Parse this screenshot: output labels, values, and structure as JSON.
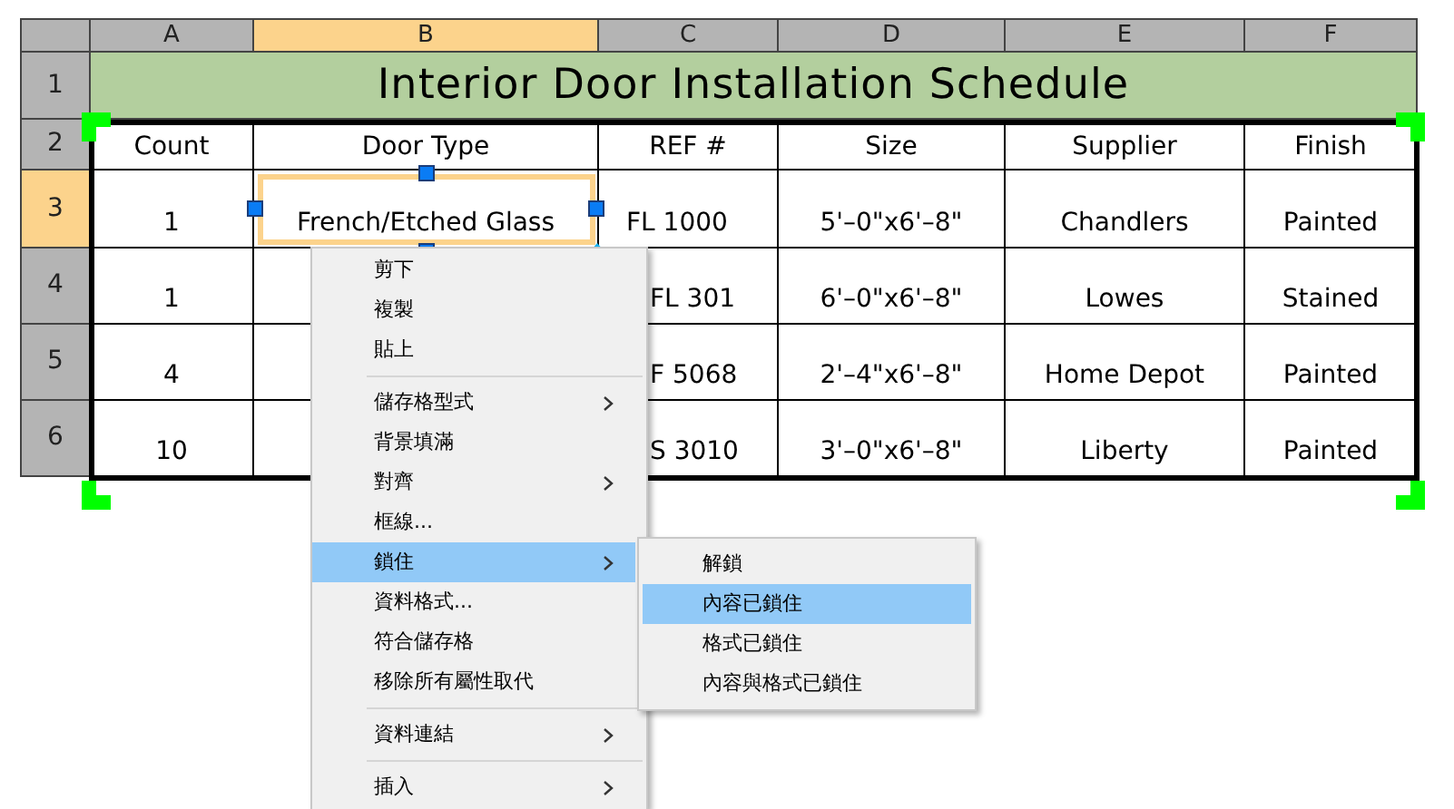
{
  "column_headers": [
    {
      "label": "A",
      "selected": false
    },
    {
      "label": "B",
      "selected": true
    },
    {
      "label": "C",
      "selected": false
    },
    {
      "label": "D",
      "selected": false
    },
    {
      "label": "E",
      "selected": false
    },
    {
      "label": "F",
      "selected": false
    }
  ],
  "row_headers": [
    {
      "label": "1",
      "selected": false
    },
    {
      "label": "2",
      "selected": false
    },
    {
      "label": "3",
      "selected": true
    },
    {
      "label": "4",
      "selected": false
    },
    {
      "label": "5",
      "selected": false
    },
    {
      "label": "6",
      "selected": false
    }
  ],
  "title": "Interior Door Installation Schedule",
  "header": [
    "Count",
    "Door Type",
    "REF #",
    "Size",
    "Supplier",
    "Finish"
  ],
  "data_rows": [
    {
      "cells": [
        {
          "text": "1",
          "selected": false
        },
        {
          "text": "French/Etched Glass",
          "selected": true
        },
        {
          "text": "FL 1000",
          "selected": false
        },
        {
          "text": "5'–0\"x6'–8\"",
          "selected": false
        },
        {
          "text": "Chandlers",
          "selected": false
        },
        {
          "text": "Painted",
          "selected": false
        }
      ]
    },
    {
      "cells": [
        {
          "text": "1",
          "selected": false
        },
        null,
        {
          "text": "FL 301",
          "selected": false
        },
        {
          "text": "6'–0\"x6'–8\"",
          "selected": false
        },
        {
          "text": "Lowes",
          "selected": false
        },
        {
          "text": "Stained",
          "selected": false
        }
      ]
    },
    {
      "cells": [
        {
          "text": "4",
          "selected": false
        },
        null,
        {
          "text": "F 5068",
          "selected": false
        },
        {
          "text": "2'–4\"x6'–8\"",
          "selected": false
        },
        {
          "text": "Home Depot",
          "selected": false
        },
        {
          "text": "Painted",
          "selected": false
        }
      ]
    },
    {
      "cells": [
        {
          "text": "10",
          "selected": false
        },
        null,
        {
          "text": "S 3010",
          "selected": false
        },
        {
          "text": "3'–0\"x6'–8\"",
          "selected": false
        },
        {
          "text": "Liberty",
          "selected": false
        },
        {
          "text": "Painted",
          "selected": false
        }
      ]
    }
  ],
  "context_menu": [
    {
      "kind": "item",
      "label": "剪下",
      "selected": false
    },
    {
      "kind": "item",
      "label": "複製",
      "selected": false
    },
    {
      "kind": "item",
      "label": "貼上",
      "selected": false
    },
    {
      "kind": "separator"
    },
    {
      "kind": "cascade",
      "label": "儲存格型式",
      "selected": false
    },
    {
      "kind": "item",
      "label": "背景填滿",
      "selected": false
    },
    {
      "kind": "cascade",
      "label": "對齊",
      "selected": false
    },
    {
      "kind": "item",
      "label": "框線...",
      "selected": false
    },
    {
      "kind": "cascade",
      "label": "鎖住",
      "selected": true
    },
    {
      "kind": "item",
      "label": "資料格式...",
      "selected": false
    },
    {
      "kind": "item",
      "label": "符合儲存格",
      "selected": false
    },
    {
      "kind": "item",
      "label": "移除所有屬性取代",
      "selected": false
    },
    {
      "kind": "separator"
    },
    {
      "kind": "cascade",
      "label": "資料連結",
      "selected": false
    },
    {
      "kind": "separator"
    },
    {
      "kind": "cascade",
      "label": "插入",
      "selected": false
    }
  ],
  "submenu": [
    {
      "label": "解鎖",
      "selected": false
    },
    {
      "label": "內容已鎖住",
      "selected": true
    },
    {
      "label": "格式已鎖住",
      "selected": false
    },
    {
      "label": "內容與格式已鎖住",
      "selected": false
    }
  ]
}
